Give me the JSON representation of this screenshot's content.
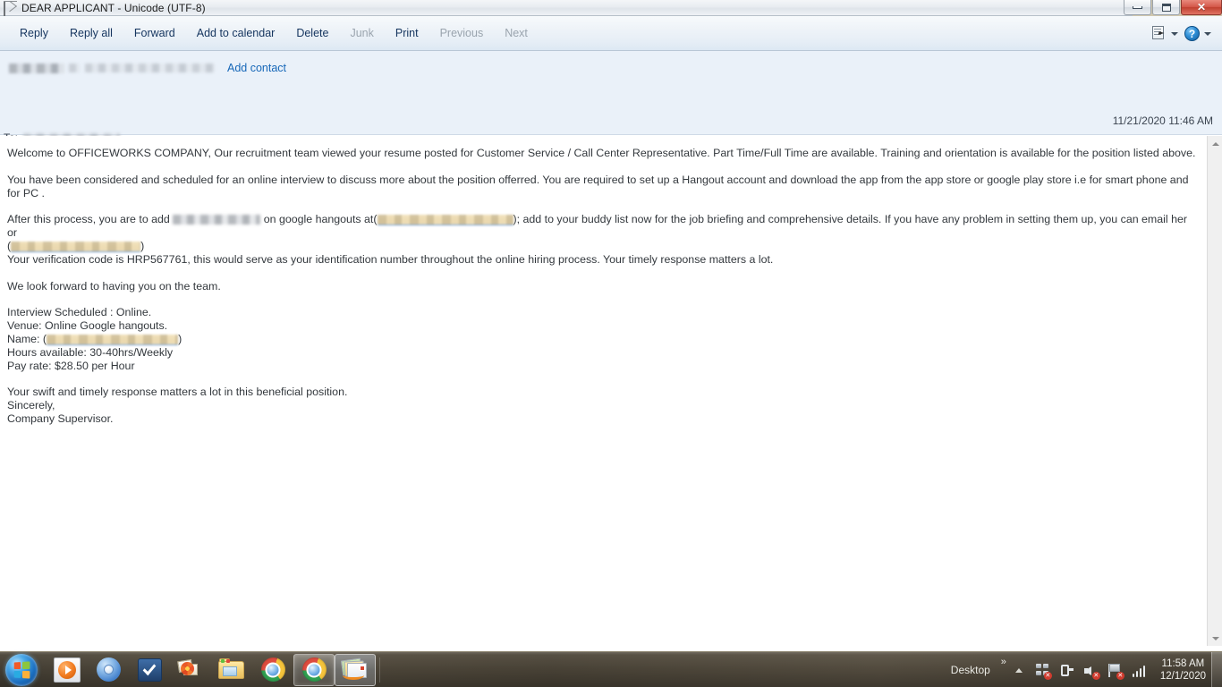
{
  "window": {
    "title": "DEAR APPLICANT - Unicode (UTF-8)",
    "icon": "envelope-icon",
    "minimize_label": "–",
    "maximize_label": "□",
    "close_label": "✕"
  },
  "toolbar": {
    "items": [
      {
        "label": "Reply",
        "disabled": false
      },
      {
        "label": "Reply all",
        "disabled": false
      },
      {
        "label": "Forward",
        "disabled": false
      },
      {
        "label": "Add to calendar",
        "disabled": false
      },
      {
        "label": "Delete",
        "disabled": false
      },
      {
        "label": "Junk",
        "disabled": true
      },
      {
        "label": "Print",
        "disabled": false
      },
      {
        "label": "Previous",
        "disabled": true
      },
      {
        "label": "Next",
        "disabled": true
      }
    ],
    "right_icons": [
      {
        "name": "select-document-icon"
      },
      {
        "name": "help-icon",
        "label": "?"
      }
    ]
  },
  "message": {
    "sender_redacted": true,
    "add_contact_label": "Add contact",
    "to_label": "To:",
    "to_redacted": true,
    "to_suffix": ",",
    "date": "11/21/2020 11:46 AM",
    "subject": "DEAR APPLICANT"
  },
  "body": {
    "p1": " Welcome to  OFFICEWORKS COMPANY, Our recruitment team viewed your resume posted   for Customer Service / Call Center Representative. Part Time/Full Time  are available.  Training and orientation is available for the position listed above.",
    "p2": "You have been considered and scheduled for an online interview to discuss more about the position offerred. You are required to set up a  Hangout account and download the app  from the app store or google play store i.e for smart phone and for PC .",
    "p3_part1": "After this process, you are to add ",
    "p3_part2": " on  google hangouts at(",
    "p3_part3": "); add to your buddy list now for the job briefing and comprehensive details. If you have any problem in setting them up, you can email her or",
    "p3_part4": "(",
    "p3_part5": ")",
    "p4": "Your verification code is HRP567761, this would serve as your identification number throughout the online hiring process. Your timely response matters a lot.",
    "p5": "We look forward to having you on the team.",
    "details": {
      "interview": "Interview Scheduled : Online.",
      "venue": "Venue: Online  Google hangouts.",
      "name_label": " Name: (",
      "name_close": ")",
      "hours": "Hours available:  30-40hrs/Weekly",
      "pay": "Pay rate: $28.50  per Hour"
    },
    "p6": "Your swift and timely response matters a lot in this beneficial position.",
    "p7": "Sincerely,",
    "p8": "Company Supervisor."
  },
  "scrollbar": {
    "up_arrow": "scroll-up-arrow",
    "down_arrow": "scroll-down-arrow"
  },
  "taskbar": {
    "start_label": "start-orb",
    "apps": [
      {
        "name": "windows-media-player-icon",
        "active": false
      },
      {
        "name": "chromium-icon",
        "active": false
      },
      {
        "name": "checkmark-app-icon",
        "active": false
      },
      {
        "name": "photo-viewer-icon",
        "active": false
      },
      {
        "name": "file-explorer-icon",
        "active": false
      },
      {
        "name": "google-chrome-icon",
        "active": false
      },
      {
        "name": "google-chrome-window-icon",
        "active": true
      },
      {
        "name": "mail-window-icon",
        "active": true
      }
    ],
    "tray": {
      "desktop_label": "Desktop",
      "overflow_label": "»",
      "icons": [
        {
          "name": "show-hidden-icons-arrow"
        },
        {
          "name": "network-icon",
          "badge": "x"
        },
        {
          "name": "power-plug-icon"
        },
        {
          "name": "speaker-muted-icon",
          "badge": "x"
        },
        {
          "name": "action-center-flag-icon",
          "badge": "x"
        },
        {
          "name": "signal-bars-icon"
        }
      ],
      "time": "11:58 AM",
      "date": "12/1/2020"
    }
  },
  "colors": {
    "link": "#1667b8",
    "header_bg": "#eaf1f9",
    "toolbar_text": "#15355f",
    "highlight": "#f0dcae"
  }
}
